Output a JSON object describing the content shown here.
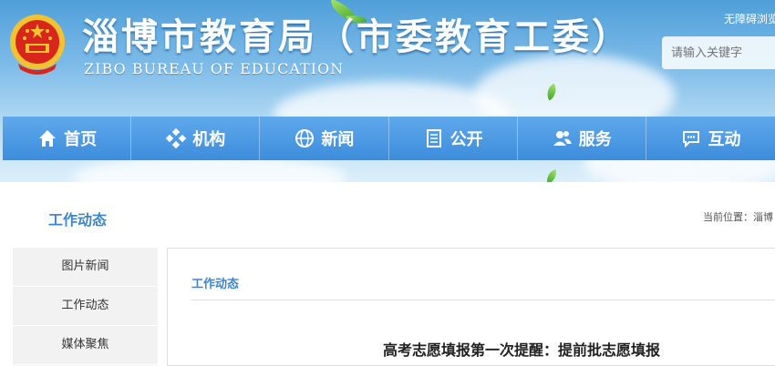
{
  "header": {
    "title": "淄博市教育局（市委教育工委）",
    "subtitle": "ZIBO BUREAU OF EDUCATION",
    "accessibility_label": "无障碍浏览",
    "search_placeholder": "请输入关键字"
  },
  "nav": {
    "items": [
      {
        "label": "首页",
        "icon": "home-icon"
      },
      {
        "label": "机构",
        "icon": "org-icon"
      },
      {
        "label": "新闻",
        "icon": "globe-icon"
      },
      {
        "label": "公开",
        "icon": "document-icon"
      },
      {
        "label": "服务",
        "icon": "users-icon"
      },
      {
        "label": "互动",
        "icon": "chat-icon"
      }
    ]
  },
  "page": {
    "section_title": "工作动态",
    "breadcrumb": "当前位置：淄博"
  },
  "sidebar": {
    "items": [
      {
        "label": "图片新闻"
      },
      {
        "label": "工作动态"
      },
      {
        "label": "媒体聚焦"
      }
    ]
  },
  "main": {
    "section_label": "工作动态",
    "article_title": "高考志愿填报第一次提醒：提前批志愿填报"
  },
  "colors": {
    "nav_blue": "#3d8ddc",
    "section_blue": "#3d86cc",
    "emblem_red": "#d8261c",
    "emblem_gold": "#f2c230"
  }
}
